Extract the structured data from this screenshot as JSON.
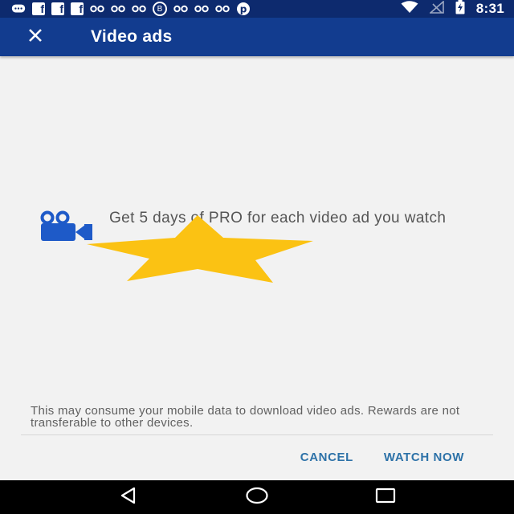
{
  "status_bar": {
    "time": "8:31",
    "notification_icons": [
      "chat-bubble-icon",
      "facebook-icon",
      "facebook-icon",
      "facebook-icon",
      "video-link-icon",
      "video-link-icon",
      "video-link-icon",
      "bold-b-icon",
      "video-link-icon",
      "video-link-icon",
      "video-link-icon",
      "pinterest-icon"
    ],
    "system_icons": [
      "wifi-icon",
      "signal-icon",
      "battery-charging-icon"
    ]
  },
  "app_bar": {
    "title": "Video ads",
    "close_icon": "close-icon",
    "background_color": "#123c8f"
  },
  "promo": {
    "icon": "video-camera-icon",
    "icon_color": "#1e5ac8",
    "text": "Get 5 days of PRO for each video ad you watch",
    "overlay": "star",
    "overlay_color": "#fbc213"
  },
  "disclaimer": "This may consume your mobile data to download video ads. Rewards are not transferable to other devices.",
  "actions": {
    "cancel_label": "CANCEL",
    "watch_label": "WATCH NOW",
    "color": "#2d72a8"
  },
  "nav_bar": {
    "buttons": [
      "back-icon",
      "home-icon",
      "recents-icon"
    ]
  }
}
